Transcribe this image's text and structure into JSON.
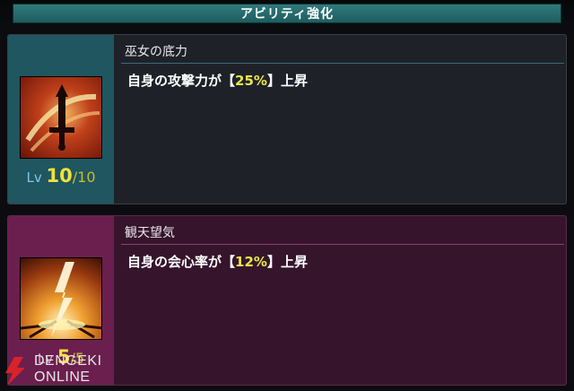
{
  "header": {
    "title": "アビリティ強化"
  },
  "abilities": [
    {
      "name": "巫女の底力",
      "desc_prefix": "自身の攻撃力が",
      "bracket_open": "【",
      "value": "25%",
      "bracket_close": "】",
      "desc_suffix": "上昇",
      "level_label": "Lv",
      "level_current": "10",
      "level_sep": "/",
      "level_max": "10",
      "icon": "sword-icon"
    },
    {
      "name": "観天望気",
      "desc_prefix": "自身の会心率が",
      "bracket_open": "【",
      "value": "12%",
      "bracket_close": "】",
      "desc_suffix": "上昇",
      "level_label": "Lv",
      "level_current": "5",
      "level_sep": "/",
      "level_max": "5",
      "icon": "lightning-icon"
    }
  ],
  "watermark": {
    "line1": "DENGEKI",
    "line2": "ONLINE"
  },
  "colors": {
    "accent_teal": "#2f7a7c",
    "accent_magenta": "#6a1f4e",
    "highlight": "#e8e84a"
  }
}
